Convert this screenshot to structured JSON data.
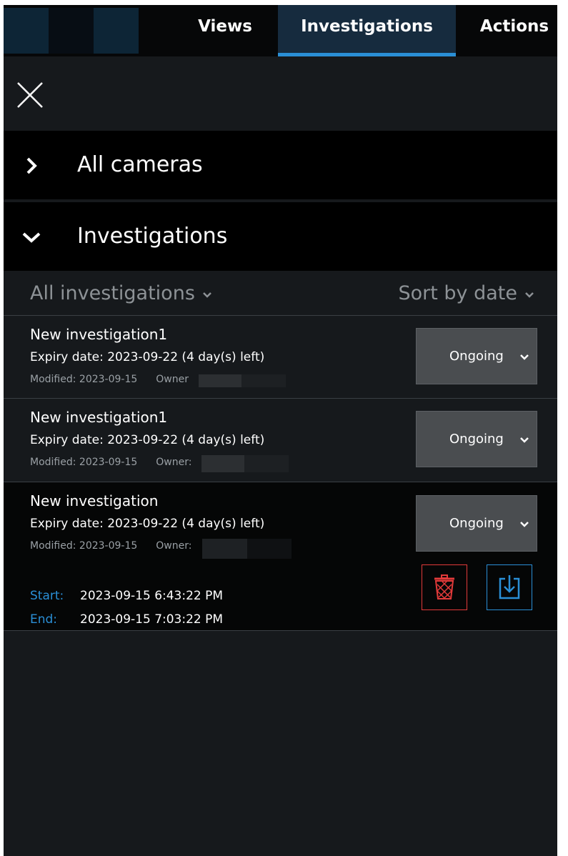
{
  "nav": {
    "tabs": [
      {
        "label": "Views"
      },
      {
        "label": "Investigations",
        "active": true
      },
      {
        "label": "Actions"
      }
    ]
  },
  "sections": {
    "all_cameras": {
      "title": "All cameras",
      "expanded": false
    },
    "investigations": {
      "title": "Investigations",
      "expanded": true
    }
  },
  "filters": {
    "scope": "All investigations",
    "sort": "Sort by date"
  },
  "labels": {
    "modified_prefix": "Modified:",
    "owner_prefix": "Owner:",
    "owner_prefix_first": "Owner",
    "start": "Start:",
    "end": "End:"
  },
  "investigations": [
    {
      "name": "New investigation1",
      "expiry": "Expiry date: 2023-09-22 (4 day(s) left)",
      "modified": "Modified: 2023-09-15",
      "status": "Ongoing"
    },
    {
      "name": "New investigation1",
      "expiry": "Expiry date: 2023-09-22 (4 day(s) left)",
      "modified": "Modified: 2023-09-15",
      "status": "Ongoing"
    },
    {
      "name": "New investigation",
      "expiry": "Expiry date: 2023-09-22 (4 day(s) left)",
      "modified": "Modified: 2023-09-15",
      "status": "Ongoing",
      "start": "2023-09-15 6:43:22 PM",
      "end": "2023-09-15 7:03:22 PM",
      "selected": true
    }
  ],
  "icons": {
    "close": "close-icon",
    "collapsed_chevron": "chevron-right-icon",
    "expanded_chevron": "chevron-down-icon",
    "delete": "trash-icon",
    "export": "export-icon"
  },
  "colors": {
    "accent": "#2a8fd6",
    "danger": "#e33a3a",
    "background": "#16191c",
    "header": "#000000",
    "selected_row": "#050606",
    "status_button": "#4a4d50"
  }
}
